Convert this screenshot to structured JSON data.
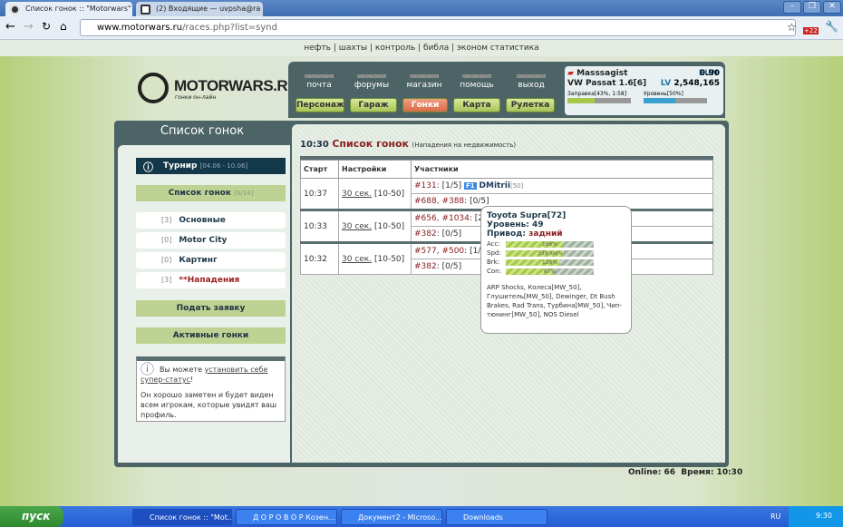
{
  "browser": {
    "tabs": [
      {
        "title": "Список гонок :: \"Motorwars\""
      },
      {
        "title": "(2) Входящие — uvpsha@ra"
      }
    ],
    "url_host": "www.motorwars.ru",
    "url_path": "/races.php?list=synd",
    "badge": "+22"
  },
  "top_links": "нефть | шахты | контроль | библа | эконом статистика",
  "logo": {
    "name": "MOTORWARS.RU",
    "tagline": "гонки он-лайн"
  },
  "nav": {
    "links": [
      "почта",
      "форумы",
      "магазин",
      "помощь",
      "выход"
    ],
    "buttons": [
      "Персонаж",
      "Гараж",
      "Гонки",
      "Карта",
      "Рулетка"
    ],
    "active": "Гонки"
  },
  "user": {
    "name": "Masssagist",
    "car": "VW Passat 1.6[6]",
    "eun_label": "EUN",
    "eun": "0.90",
    "lv_label": "LV",
    "lv": "2,548,165",
    "fuel_label": "Заправка[43%, 1:58]",
    "fuel": 43,
    "level_label": "Уровень[50%]",
    "level": 50
  },
  "sidebar": {
    "title": "Список гонок",
    "tournament": {
      "label": "Турнир",
      "dates": "[04.06 - 10.06]"
    },
    "race_list": {
      "label": "Список гонок",
      "count": "[6/14]"
    },
    "items": [
      {
        "count": "[3]",
        "label": "Основные"
      },
      {
        "count": "[0]",
        "label": "Motor City"
      },
      {
        "count": "[0]",
        "label": "Картинг"
      },
      {
        "count": "[3]",
        "label": "**Нападения"
      }
    ],
    "apply": "Подать заявку",
    "active_races": "Активные гонки",
    "info": {
      "pre": "Вы можете ",
      "link": "установить себе супер-статус",
      "post": "!",
      "body": "Он хорошо заметен и будет виден всем игрокам, которые увидят ваш профиль."
    }
  },
  "main": {
    "time": "10:30",
    "title": "Список гонок",
    "subtitle": "(Нападения на недвижимость)",
    "columns": [
      "Старт",
      "Настройки",
      "Участники"
    ],
    "races": [
      {
        "start": "10:37",
        "setting_link": "30 сек.",
        "setting_range": "[10-50]",
        "p1_ids": "#131",
        "p1_slots": ": [1/5]",
        "player": "DMitrii",
        "player_lvl": "[50]",
        "p2_ids": "#688, #388",
        "p2_slots": ": [0/5]"
      },
      {
        "start": "10:33",
        "setting_link": "30 сек.",
        "setting_range": "[10-50]",
        "p1_ids": "#656, #1034",
        "p1_slots": ": [2/5]",
        "p2_ids": "#382",
        "p2_slots": ": [0/5]"
      },
      {
        "start": "10:32",
        "setting_link": "30 сек.",
        "setting_range": "[10-50]",
        "p1_ids": "#577, #500",
        "p1_slots": ": [1/5]",
        "p2_ids": "#382",
        "p2_slots": ": [0/5]"
      }
    ]
  },
  "tooltip": {
    "car": "Toyota Supra[72]",
    "level": "Уровень: 49",
    "drive_label": "Привод:",
    "drive": "задний",
    "stats": [
      {
        "label": "Acc:",
        "value": "166%",
        "fill": 0.65
      },
      {
        "label": "Spd:",
        "value": "339 км/ч",
        "fill": 0.65
      },
      {
        "label": "Brk:",
        "value": "128%",
        "fill": 0.62
      },
      {
        "label": "Con:",
        "value": "87%",
        "fill": 0.55
      }
    ],
    "parts": "ARP Shocks, Колеса[MW_50], Глушитель[MW_50], Dewinger, Dt Bush Brakes, Rad Trans, Турбина[MW_50], Чип-тюнинг[MW_50], NOS Diesel"
  },
  "footer": {
    "online": "Online: 66",
    "time": "Время: 10:30"
  },
  "taskbar": {
    "start": "пуск",
    "tasks": [
      "Список гонок :: \"Mot...",
      "Д О Р О В О Р Козен...",
      "Документ2 - Microso...",
      "Downloads"
    ],
    "lang": "RU",
    "clock": "9:30"
  }
}
